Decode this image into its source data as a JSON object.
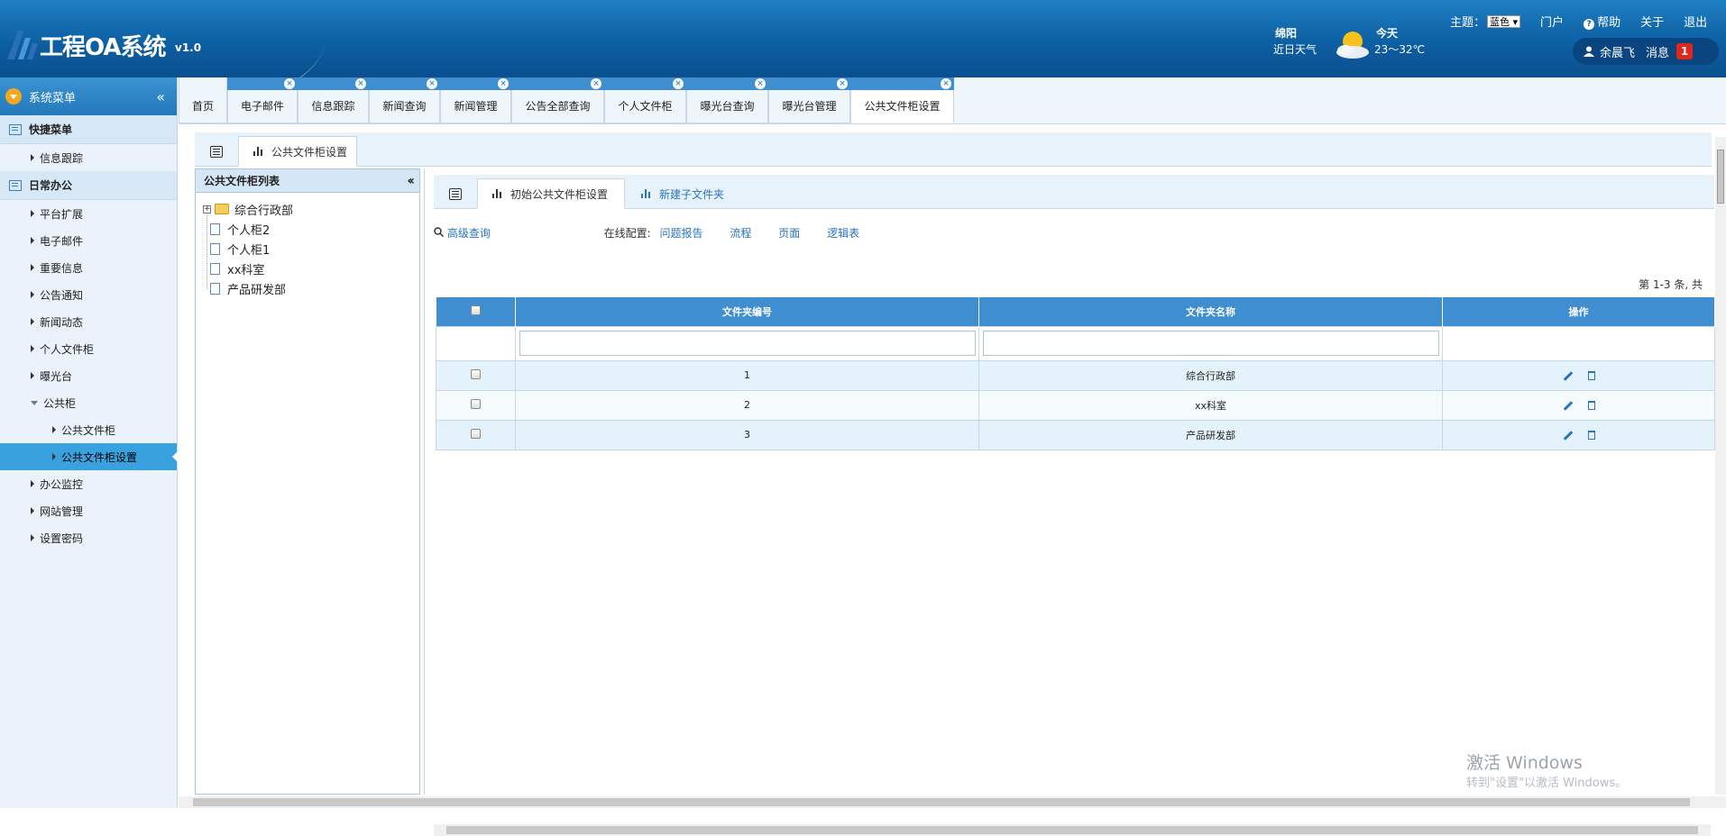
{
  "header": {
    "title": "工程OA系统",
    "version": "v1.0",
    "weather": {
      "city": "绵阳",
      "recent_label": "近日天气",
      "today_label": "今天",
      "temp": "23～32℃"
    },
    "theme_label": "主题：",
    "theme_value": "蓝色",
    "links": {
      "portal": "门户",
      "help": "帮助",
      "about": "关于",
      "logout": "退出"
    },
    "user_name": "余晨飞",
    "messages_label": "消息",
    "messages_count": "1"
  },
  "sidebar": {
    "header": "系统菜单",
    "quick_menu": "快捷菜单",
    "quick_items": [
      "信息跟踪"
    ],
    "daily_office": "日常办公",
    "items": [
      "平台扩展",
      "电子邮件",
      "重要信息",
      "公告通知",
      "新闻动态",
      "个人文件柜",
      "曝光台",
      "公共柜"
    ],
    "sub_items": [
      "公共文件柜",
      "公共文件柜设置"
    ],
    "items_after": [
      "办公监控",
      "网站管理",
      "设置密码"
    ]
  },
  "tabs": [
    "首页",
    "电子邮件",
    "信息跟踪",
    "新闻查询",
    "新闻管理",
    "公告全部查询",
    "个人文件柜",
    "曝光台查询",
    "曝光台管理",
    "公共文件柜设置"
  ],
  "panel": {
    "tab_label": "公共文件柜设置",
    "tree_title": "公共文件柜列表",
    "tree": [
      "综合行政部",
      "个人柜2",
      "个人柜1",
      "xx科室",
      "产品研发部"
    ],
    "work_tabs": [
      "初始公共文件柜设置",
      "新建子文件夹"
    ],
    "toolbar": {
      "advanced_search": "高级查询",
      "online_config": "在线配置:",
      "links": [
        "问题报告",
        "流程",
        "页面",
        "逻辑表"
      ]
    },
    "pager": "第 1-3 条, 共",
    "grid": {
      "headers": [
        "文件夹编号",
        "文件夹名称",
        "操作"
      ],
      "rows": [
        {
          "id": "1",
          "name": "综合行政部"
        },
        {
          "id": "2",
          "name": "xx科室"
        },
        {
          "id": "3",
          "name": "产品研发部"
        }
      ]
    }
  },
  "watermark": {
    "line1": "激活 Windows",
    "line2": "转到\"设置\"以激活 Windows。"
  },
  "colors": {
    "header_blue": "#0d5fa3",
    "accent_blue": "#3f8fd0",
    "active_item": "#3aa1df",
    "badge_red": "#e1261c"
  }
}
